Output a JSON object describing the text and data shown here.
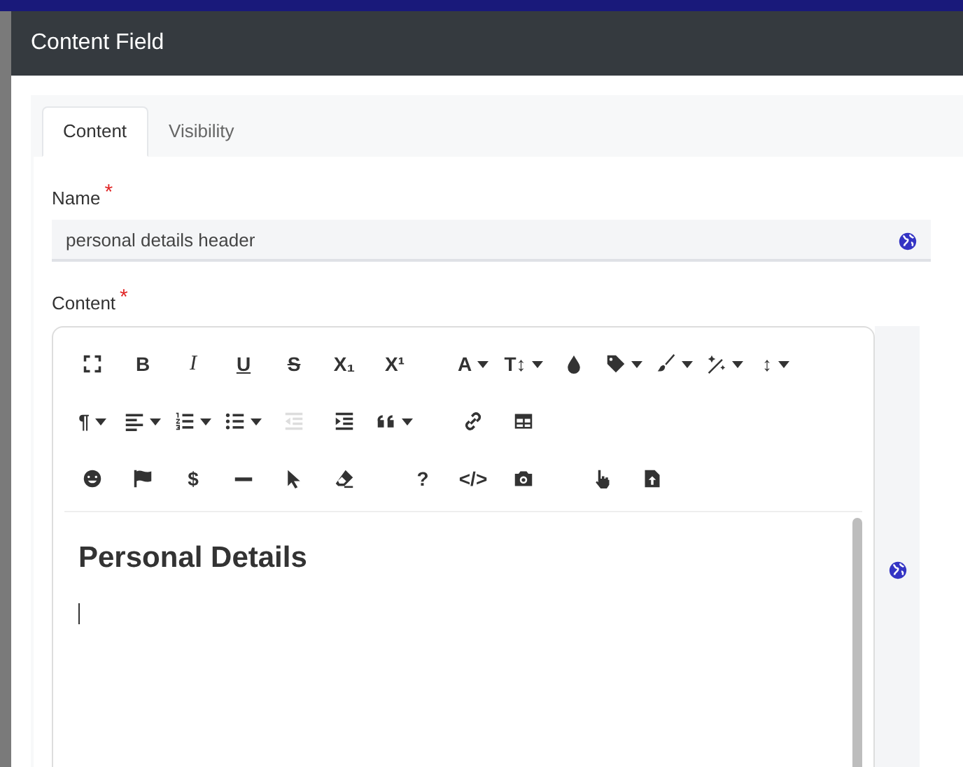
{
  "modal": {
    "title": "Content Field",
    "tabs": [
      {
        "label": "Content",
        "selected": true
      },
      {
        "label": "Visibility",
        "selected": false
      }
    ],
    "name_field": {
      "label": "Name",
      "required_mark": "*",
      "value": "personal details header"
    },
    "content_field": {
      "label": "Content",
      "required_mark": "*",
      "toolbar": [
        [
          [
            {
              "kind": "fullscreen",
              "dropdown": false,
              "disabled": false
            },
            {
              "kind": "bold",
              "glyph": "B",
              "dropdown": false,
              "disabled": false
            },
            {
              "kind": "italic",
              "glyph": "I",
              "dropdown": false,
              "disabled": false
            },
            {
              "kind": "underline",
              "glyph": "U",
              "dropdown": false,
              "disabled": false
            },
            {
              "kind": "strike",
              "glyph": "S",
              "dropdown": false,
              "disabled": false
            },
            {
              "kind": "heavy",
              "glyph": "X₁",
              "dropdown": false,
              "disabled": false
            },
            {
              "kind": "heavy",
              "glyph": "X¹",
              "dropdown": false,
              "disabled": false
            }
          ],
          [
            {
              "kind": "heavy",
              "glyph": "A",
              "dropdown": true,
              "disabled": false
            },
            {
              "kind": "heavy",
              "glyph": "T↕",
              "dropdown": true,
              "disabled": false
            },
            {
              "kind": "drop",
              "dropdown": false,
              "disabled": false
            },
            {
              "kind": "tag",
              "dropdown": true,
              "disabled": false
            },
            {
              "kind": "brush",
              "dropdown": true,
              "disabled": false
            },
            {
              "kind": "wand",
              "dropdown": true,
              "disabled": false
            },
            {
              "kind": "heavy",
              "glyph": "↕",
              "dropdown": true,
              "disabled": false
            }
          ]
        ],
        [
          [
            {
              "kind": "heavy",
              "glyph": "¶",
              "dropdown": true,
              "disabled": false
            },
            {
              "kind": "align",
              "dropdown": true,
              "disabled": false
            },
            {
              "kind": "numbered",
              "dropdown": true,
              "disabled": false
            },
            {
              "kind": "bulleted",
              "dropdown": true,
              "disabled": false
            },
            {
              "kind": "outdent",
              "dropdown": false,
              "disabled": true
            },
            {
              "kind": "indent",
              "dropdown": false,
              "disabled": false
            },
            {
              "kind": "quote",
              "dropdown": true,
              "disabled": false
            }
          ],
          [
            {
              "kind": "link",
              "dropdown": false,
              "disabled": false
            },
            {
              "kind": "table",
              "dropdown": false,
              "disabled": false
            }
          ]
        ],
        [
          [
            {
              "kind": "smile",
              "dropdown": false,
              "disabled": false
            },
            {
              "kind": "flag",
              "dropdown": false,
              "disabled": false
            },
            {
              "kind": "heavy",
              "glyph": "$",
              "dropdown": false,
              "disabled": false
            },
            {
              "kind": "rule",
              "dropdown": false,
              "disabled": false
            },
            {
              "kind": "pointer",
              "dropdown": false,
              "disabled": false
            },
            {
              "kind": "eraser",
              "dropdown": false,
              "disabled": false
            }
          ],
          [
            {
              "kind": "heavy",
              "glyph": "?",
              "dropdown": false,
              "disabled": false
            },
            {
              "kind": "heavy",
              "glyph": "</>",
              "dropdown": false,
              "disabled": false
            },
            {
              "kind": "camera",
              "dropdown": false,
              "disabled": false
            }
          ],
          [
            {
              "kind": "hand",
              "dropdown": false,
              "disabled": false
            },
            {
              "kind": "file",
              "dropdown": false,
              "disabled": false
            }
          ]
        ]
      ],
      "heading": "Personal Details"
    }
  }
}
